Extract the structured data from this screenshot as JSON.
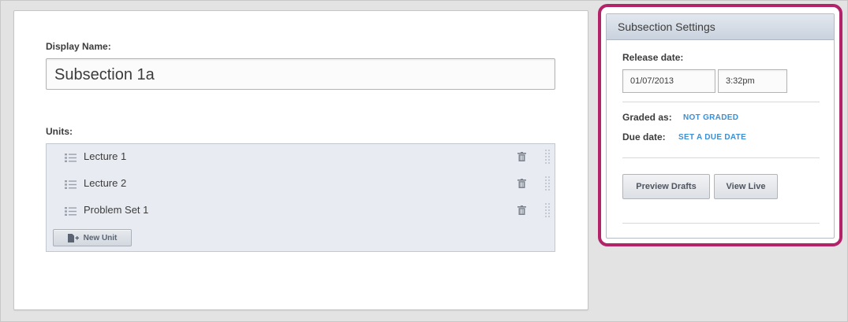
{
  "editor": {
    "display_name_label": "Display Name:",
    "display_name_value": "Subsection 1a",
    "units_label": "Units:",
    "units": [
      {
        "label": "Lecture 1",
        "icon": "list-icon"
      },
      {
        "label": "Lecture 2",
        "icon": "list-icon"
      },
      {
        "label": "Problem Set 1",
        "icon": "list-icon"
      }
    ],
    "new_unit_label": "New Unit"
  },
  "settings": {
    "title": "Subsection Settings",
    "release_label": "Release date:",
    "release_date": "01/07/2013",
    "release_time": "3:32pm",
    "graded_label": "Graded as:",
    "graded_value": "NOT GRADED",
    "due_label": "Due date:",
    "due_value": "SET A DUE DATE",
    "preview_button": "Preview Drafts",
    "view_live_button": "View Live"
  },
  "colors": {
    "highlight": "#b3236a",
    "link": "#3b8fd6",
    "units_bg": "#e8ecf2"
  }
}
